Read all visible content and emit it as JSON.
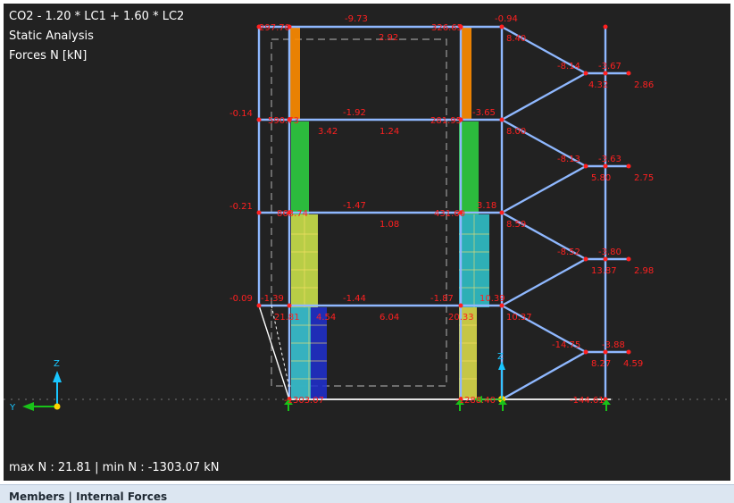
{
  "viewport": {
    "load_combo": "CO2 - 1.20 * LC1 + 1.60 * LC2",
    "analysis_type": "Static Analysis",
    "result_type": "Forces N [kN]",
    "summary": "max N : 21.81 | min N : -1303.07 kN",
    "axis_z": "Z",
    "axis_y": "Y",
    "colors": {
      "background": "#222222",
      "member": "#8fb8ff",
      "value_label": "#ff2020",
      "support": "#19c219",
      "axis": "#19c6ff",
      "origin": "#ffd400"
    },
    "labels": {
      "l01": "297.70",
      "l02": "-9.73",
      "l03": "2.92",
      "l04": "326.65",
      "l05": "-0.94",
      "l06": "8.40",
      "l07": "-8.14",
      "l08": "-3.67",
      "l09": "4.32",
      "l10": "2.86",
      "l11": "-0.14",
      "l12": "590.73",
      "l13": "-1.92",
      "l14": "3.42",
      "l15": "1.24",
      "l16": "281.95",
      "l17": "-3.65",
      "l18": "8.00",
      "l19": "-8.13",
      "l20": "-3.63",
      "l21": "5.80",
      "l22": "2.75",
      "l23": "-0.21",
      "l24": "863.74",
      "l25": "-1.47",
      "l26": "1.08",
      "l27": "431.60",
      "l28": "3.18",
      "l29": "8.59",
      "l30": "-8.52",
      "l31": "-3.80",
      "l32": "13.87",
      "l33": "2.98",
      "l34": "-0.09",
      "l35": "-1.39",
      "l36": "-1.44",
      "l37": "6.04",
      "l38": "-1.87",
      "l39": "10.39",
      "l40": "21.81",
      "l41": "4.54",
      "l42": "20.33",
      "l43": "10.37",
      "l44": "-14.75",
      "l45": "-3.88",
      "l46": "8.27",
      "l47": "4.59",
      "l48": "-1303.07",
      "l49": "-1288.40",
      "l50": "-144.61"
    }
  },
  "bottom_panel": {
    "title": "Members | Internal Forces"
  }
}
